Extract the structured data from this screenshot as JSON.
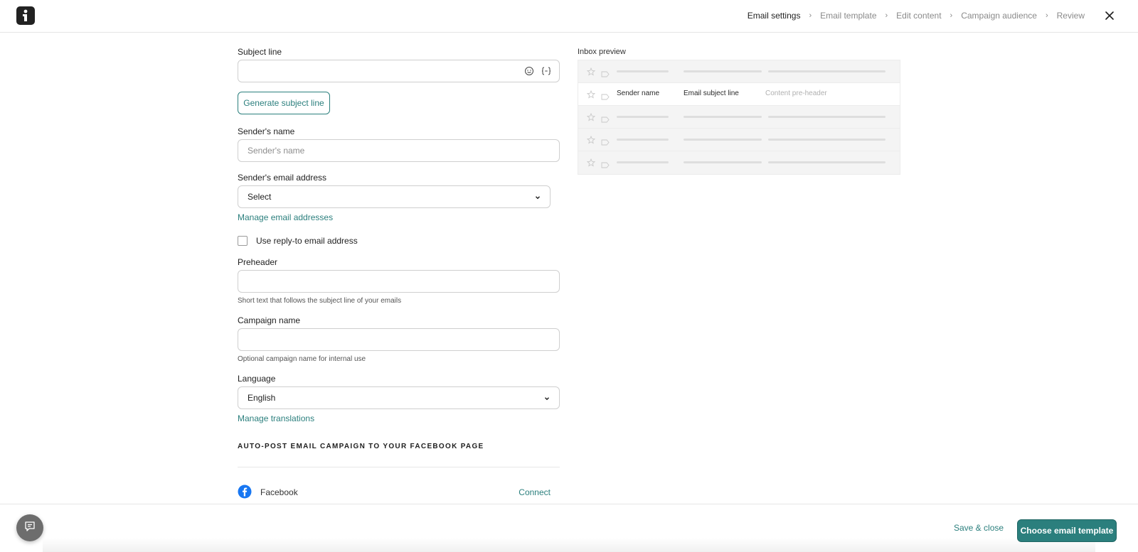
{
  "header": {
    "steps": [
      {
        "label": "Email settings",
        "active": true
      },
      {
        "label": "Email template",
        "active": false
      },
      {
        "label": "Edit content",
        "active": false
      },
      {
        "label": "Campaign audience",
        "active": false
      },
      {
        "label": "Review",
        "active": false
      }
    ],
    "close_icon": "close-icon",
    "logo_icon": "brand-logo"
  },
  "form": {
    "subject_line": {
      "label": "Subject line",
      "value": "",
      "icons": [
        "emoji-icon",
        "personalization-braces-icon"
      ]
    },
    "generate_button": "Generate subject line",
    "sender_name": {
      "label": "Sender's name",
      "placeholder": "Sender's name"
    },
    "sender_email": {
      "label": "Sender's email address",
      "value": "Select"
    },
    "manage_emails_link": "Manage email addresses",
    "reply_to_checkbox": {
      "label": "Use reply-to email address",
      "checked": false
    },
    "preheader": {
      "label": "Preheader",
      "value": "",
      "hint": "Short text that follows the subject line of your emails"
    },
    "campaign_name": {
      "label": "Campaign name",
      "value": "",
      "hint": "Optional campaign name for internal use"
    },
    "language": {
      "label": "Language",
      "value": "English"
    },
    "manage_translations_link": "Manage translations",
    "facebook_section": {
      "title": "AUTO-POST EMAIL CAMPAIGN TO YOUR FACEBOOK PAGE",
      "service_name": "Facebook",
      "connect_label": "Connect"
    }
  },
  "preview": {
    "title": "Inbox preview",
    "highlight_row": {
      "sender": "Sender name",
      "subject": "Email subject line",
      "preheader": "Content pre-header"
    }
  },
  "footer": {
    "save_close": "Save & close",
    "primary": "Choose email template",
    "chat_icon": "chat-icon"
  },
  "colors": {
    "accent": "#2b7f7d",
    "border": "#cfcfcf",
    "preview_bg": "#f4f4f4"
  }
}
